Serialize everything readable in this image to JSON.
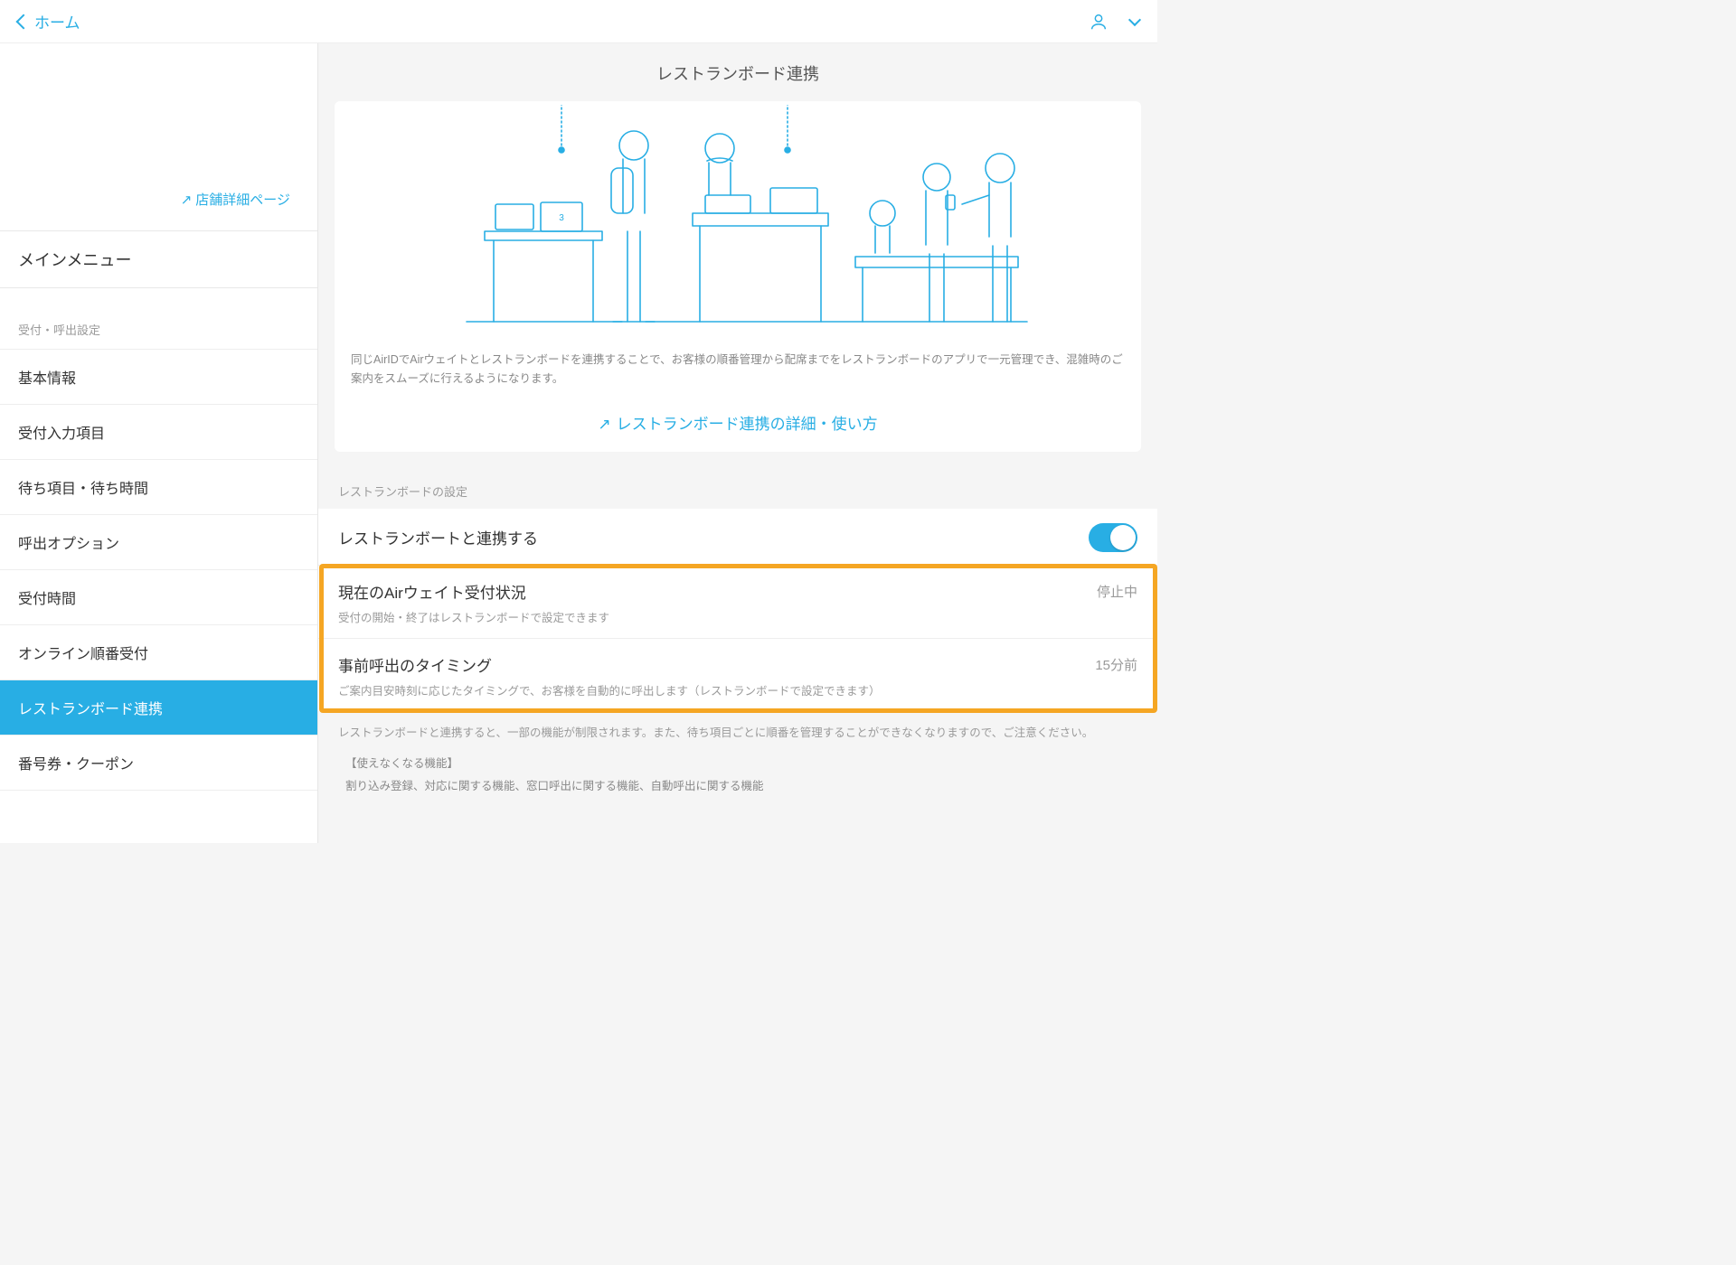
{
  "topbar": {
    "back_label": "ホーム"
  },
  "sidebar": {
    "shop_link": "店舗詳細ページ",
    "main_menu": "メインメニュー",
    "section_label": "受付・呼出設定",
    "items": [
      "基本情報",
      "受付入力項目",
      "待ち項目・待ち時間",
      "呼出オプション",
      "受付時間",
      "オンライン順番受付",
      "レストランボード連携",
      "番号券・クーポン"
    ]
  },
  "main": {
    "title": "レストランボード連携",
    "card_text": "同じAirIDでAirウェイトとレストランボードを連携することで、お客様の順番管理から配席までをレストランボードのアプリで一元管理でき、混雑時のご案内をスムーズに行えるようになります。",
    "card_link": "レストランボード連携の詳細・使い方",
    "sub_label": "レストランボードの設定",
    "rows": [
      {
        "title": "レストランボートと連携する",
        "desc": "",
        "value": ""
      },
      {
        "title": "現在のAirウェイト受付状況",
        "desc": "受付の開始・終了はレストランボードで設定できます",
        "value": "停止中"
      },
      {
        "title": "事前呼出のタイミング",
        "desc": "ご案内目安時刻に応じたタイミングで、お客様を自動的に呼出します（レストランボードで設定できます）",
        "value": "15分前"
      }
    ],
    "note1": "レストランボードと連携すると、一部の機能が制限されます。また、待ち項目ごとに順番を管理することができなくなりますので、ご注意ください。",
    "note2": "【使えなくなる機能】",
    "note3": "割り込み登録、対応に関する機能、窓口呼出に関する機能、自動呼出に関する機能"
  }
}
